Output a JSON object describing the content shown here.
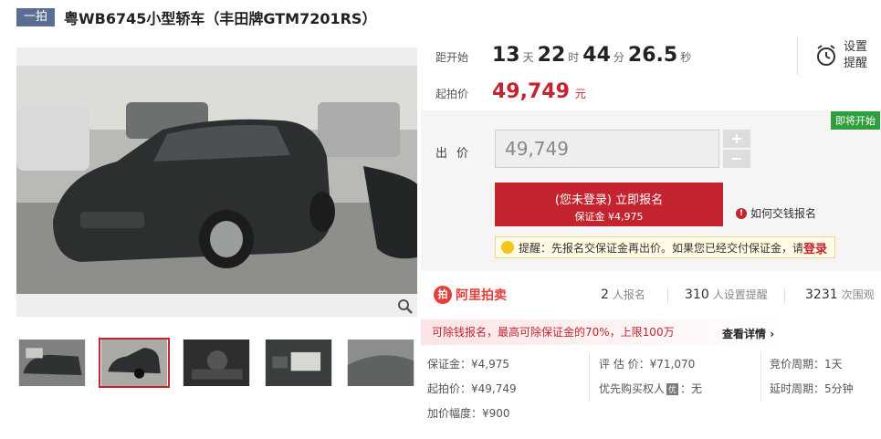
{
  "header": {
    "round_tag": "一拍",
    "title": "粤WB6745小型轿车（丰田牌GTM7201RS）"
  },
  "countdown": {
    "label": "距开始",
    "days": "13",
    "days_unit": "天",
    "hours": "22",
    "hours_unit": "时",
    "minutes": "44",
    "minutes_unit": "分",
    "seconds": "26.5",
    "seconds_unit": "秒"
  },
  "reminder": {
    "line1": "设置",
    "line2": "提醒",
    "icon": "alarm-clock-icon"
  },
  "start_price": {
    "label": "起拍价",
    "value": "49,749",
    "unit": "元"
  },
  "bid": {
    "badge": "即将开始",
    "label": "出价",
    "input_value": "49,749",
    "plus": "+",
    "minus": "−",
    "signup_line1": "(您未登录) 立即报名",
    "signup_line2": "保证金 ¥4,975",
    "help_link": "如何交钱报名",
    "hint_text": "提醒：先报名交保证金再出价。如果您已经交付保证金，请",
    "hint_login": "登录"
  },
  "stats": {
    "logo_text": "阿里拍卖",
    "signups": "2",
    "signups_unit": "人报名",
    "reminders": "310",
    "reminders_unit": "人设置提醒",
    "views": "3231",
    "views_unit": "次围观"
  },
  "deposit_bar": {
    "text": "可除钱报名，最高可除保证金的70%，上限100万",
    "link": "查看详情"
  },
  "details": {
    "deposit": "保证金：¥4,975",
    "appraisal": "评 估 价：¥71,070",
    "cycle": "竞价周期：1天",
    "start_price": "起拍价：¥49,749",
    "priority_prefix": "优先购买权人",
    "priority_badge": "优",
    "priority_suffix": "：无",
    "delay": "延时周期：5分钟",
    "increment": "加价幅度：¥900"
  },
  "colors": {
    "accent": "#c3242f",
    "badge_green": "#2e9f3c",
    "tag_blue": "#5b6e92"
  }
}
